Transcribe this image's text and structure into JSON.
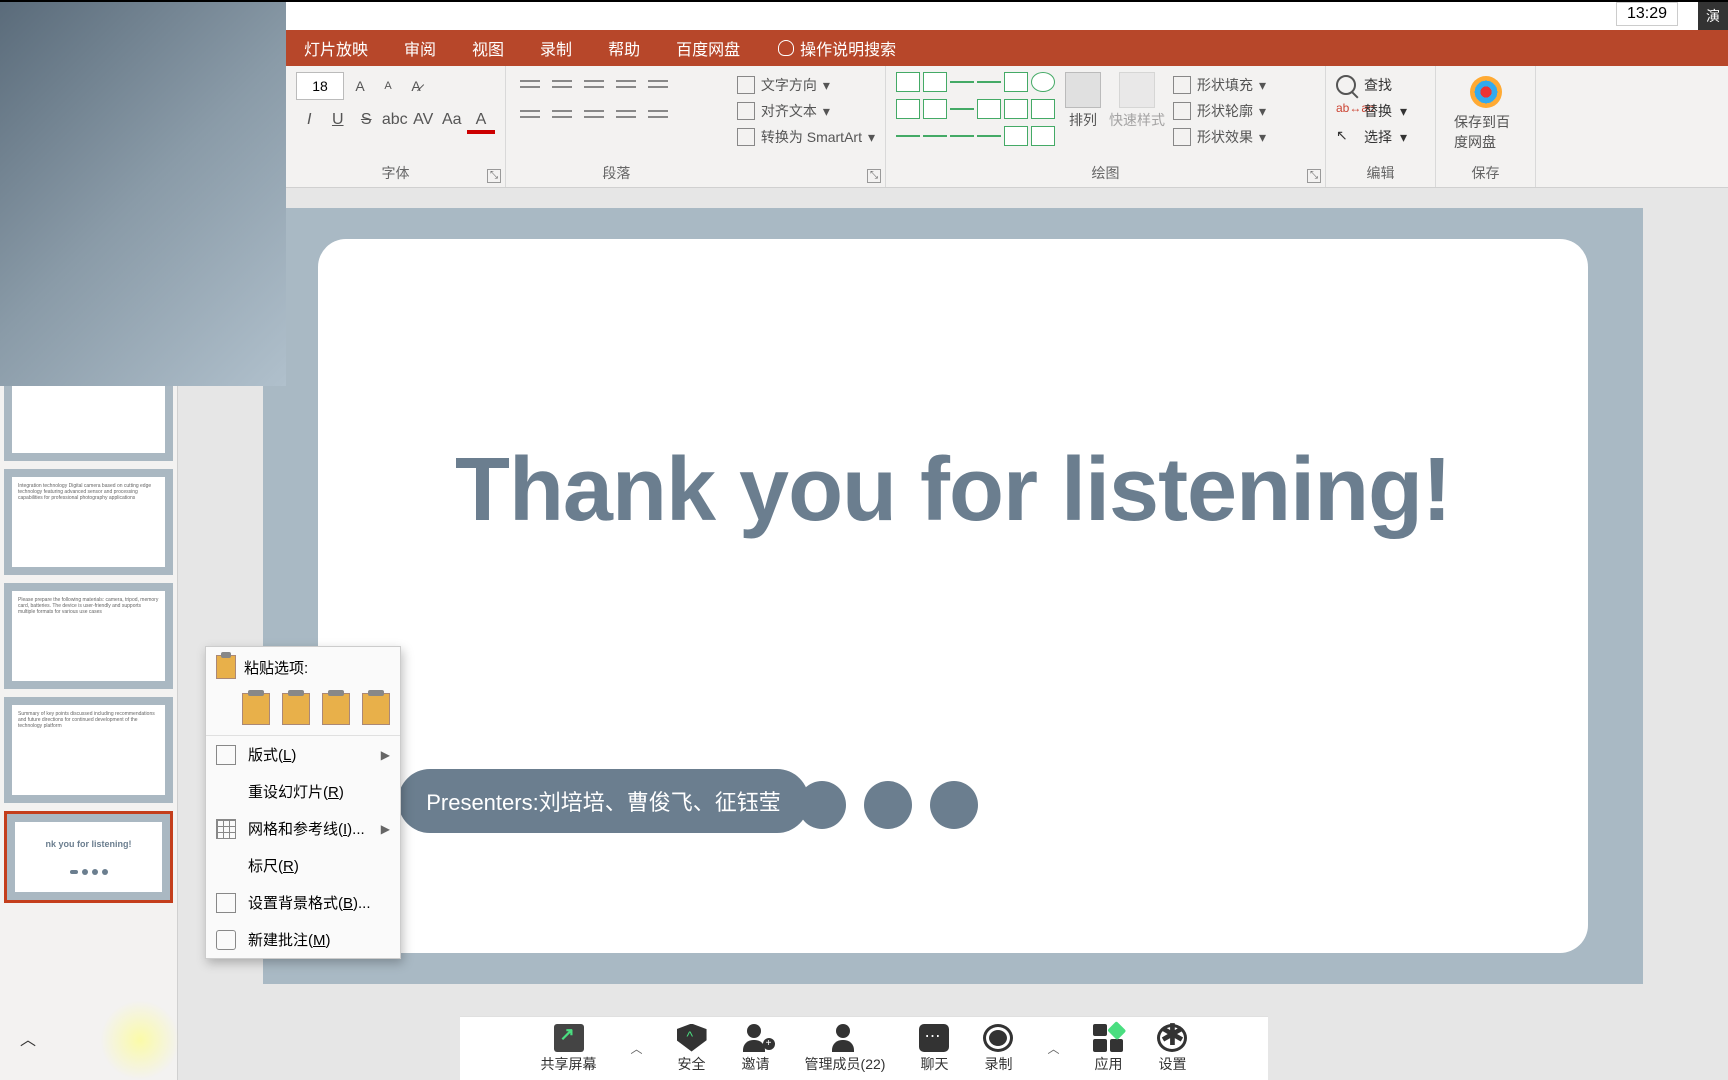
{
  "time": "13:29",
  "presenter_badge": "演",
  "ribbon": {
    "tabs": [
      "灯片放映",
      "审阅",
      "视图",
      "录制",
      "帮助",
      "百度网盘"
    ],
    "search_hint": "操作说明搜索",
    "font_size": "18",
    "groups": {
      "font": "字体",
      "paragraph": "段落",
      "drawing": "绘图",
      "editing": "编辑",
      "save": "保存"
    },
    "para_side": {
      "text_dir": "文字方向",
      "align_text": "对齐文本",
      "smartart": "转换为 SmartArt"
    },
    "draw_btns": {
      "arrange": "排列",
      "quick_style": "快速样式"
    },
    "shape_styles": {
      "fill": "形状填充",
      "outline": "形状轮廓",
      "effects": "形状效果"
    },
    "editing": {
      "find": "查找",
      "replace": "替换",
      "select": "选择"
    },
    "baidu": "保存到百度网盘"
  },
  "slide": {
    "title": "Thank you for listening!",
    "presenters": "Presenters:刘培培、曹俊飞、征钰莹"
  },
  "thumb_last_title": "nk you for listening!",
  "context_menu": {
    "paste_header": "粘贴选项:",
    "layout": "版式(L)",
    "reset": "重设幻灯片(R)",
    "grid": "网格和参考线(I)...",
    "ruler": "标尺(R)",
    "background": "设置背景格式(B)...",
    "comment": "新建批注(M)"
  },
  "zoom": {
    "share": "共享屏幕",
    "security": "安全",
    "invite": "邀请",
    "manage": "管理成员(22)",
    "chat": "聊天",
    "record": "录制",
    "apps": "应用",
    "settings": "设置"
  }
}
